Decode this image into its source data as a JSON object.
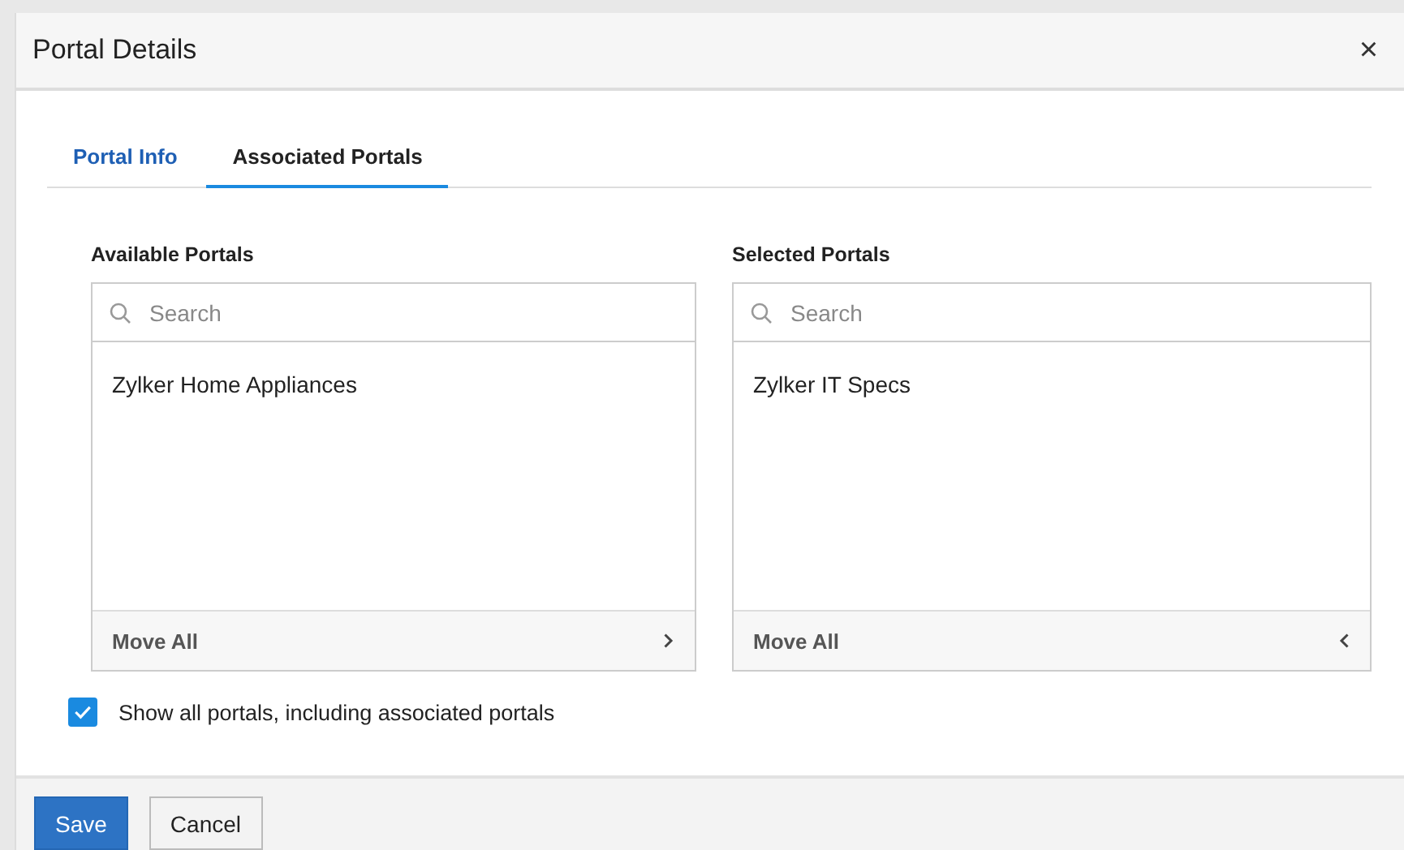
{
  "window": {
    "title": "Portal Details",
    "close": "×"
  },
  "tabs": [
    {
      "label": "Portal Info",
      "selected": false
    },
    {
      "label": "Associated Portals",
      "selected": true
    }
  ],
  "lists": [
    {
      "title": "Available Portals",
      "search": {
        "placeholder": "Search"
      },
      "items": [
        "Zylker Home Appliances"
      ],
      "move_all": "Move All",
      "kind": "source"
    },
    {
      "title": "Selected Portals",
      "search": {
        "placeholder": "Search"
      },
      "items": [
        "Zylker IT Specs"
      ],
      "move_all": "Move All",
      "kind": "target"
    }
  ],
  "option": {
    "label": "Show all portals, including associated portals",
    "checked": true
  },
  "buttons": [
    {
      "label": "Save",
      "kind": "primary"
    },
    {
      "label": "Cancel",
      "kind": "secondary"
    }
  ]
}
